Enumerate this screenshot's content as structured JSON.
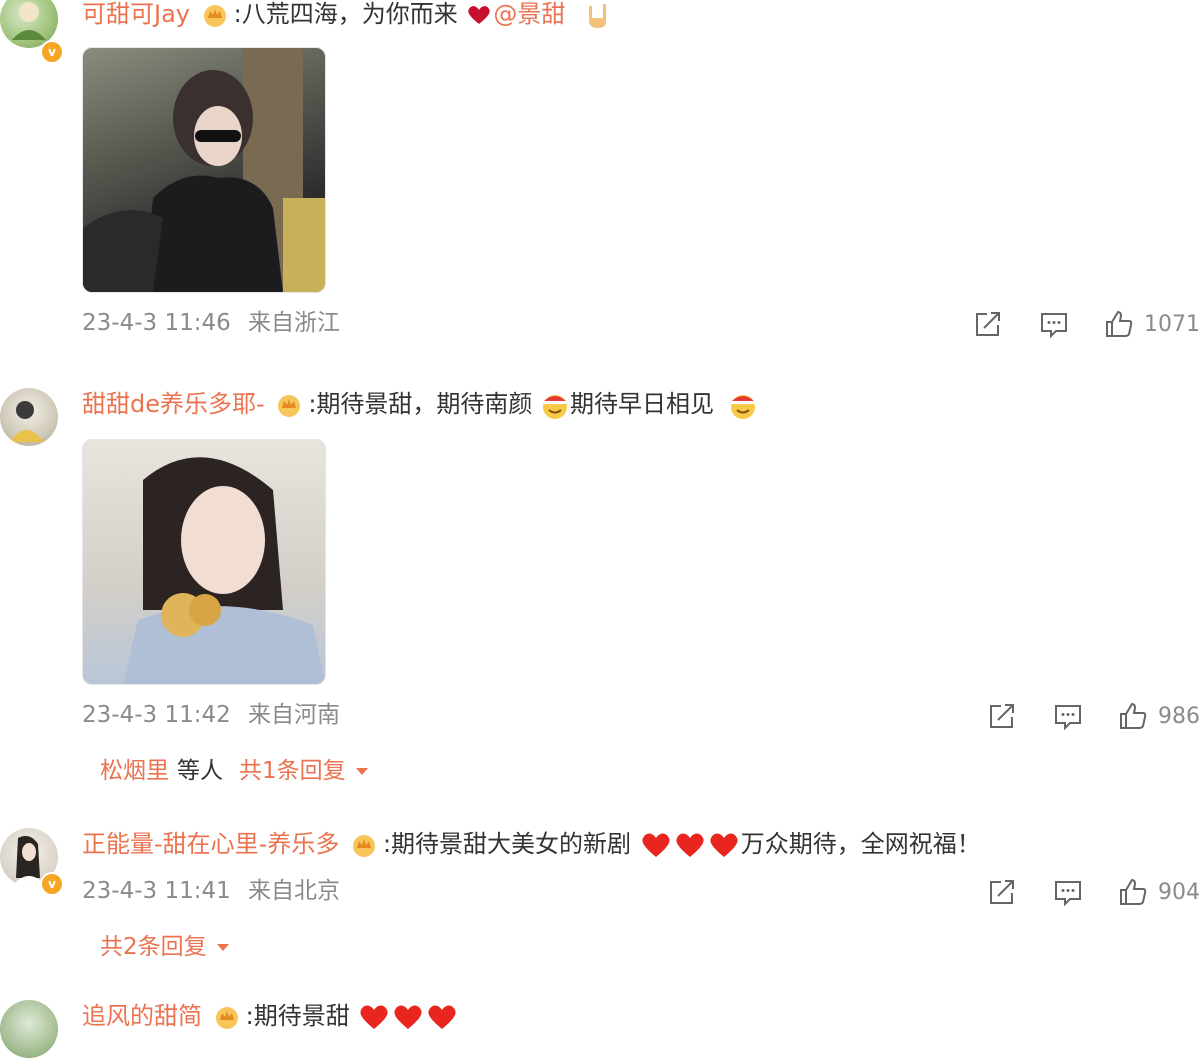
{
  "comments": [
    {
      "username": "可甜可Jay",
      "text_1": ":八荒四海，为你而来",
      "mention": "@景甜",
      "timestamp": "23-4-3 11:46",
      "location": "来自浙江",
      "likes": "1071"
    },
    {
      "username": "甜甜de养乐多耶-",
      "text_1": ":期待景甜，期待南颜",
      "text_2": "期待早日相见",
      "timestamp": "23-4-3 11:42",
      "location": "来自河南",
      "likes": "986",
      "reply_user": "松烟里",
      "reply_text": "等人",
      "reply_count": "共1条回复"
    },
    {
      "username": "正能量-甜在心里-养乐多",
      "text_1": ":期待景甜大美女的新剧",
      "text_2": "万众期待，全网祝福！",
      "timestamp": "23-4-3 11:41",
      "location": "来自北京",
      "likes": "904",
      "reply_count": "共2条回复"
    },
    {
      "username": "追风的甜简",
      "text_1": ":期待景甜"
    }
  ],
  "colors": {
    "username": "#eb7350",
    "meta": "#8a8a8a",
    "heart": "#e8261f",
    "verified": "#f5a623"
  },
  "icons": [
    "crown-badge-icon",
    "verified-badge-icon",
    "share-icon",
    "comment-icon",
    "like-icon",
    "heart-icon",
    "santa-emoji-icon",
    "rock-hand-icon"
  ]
}
